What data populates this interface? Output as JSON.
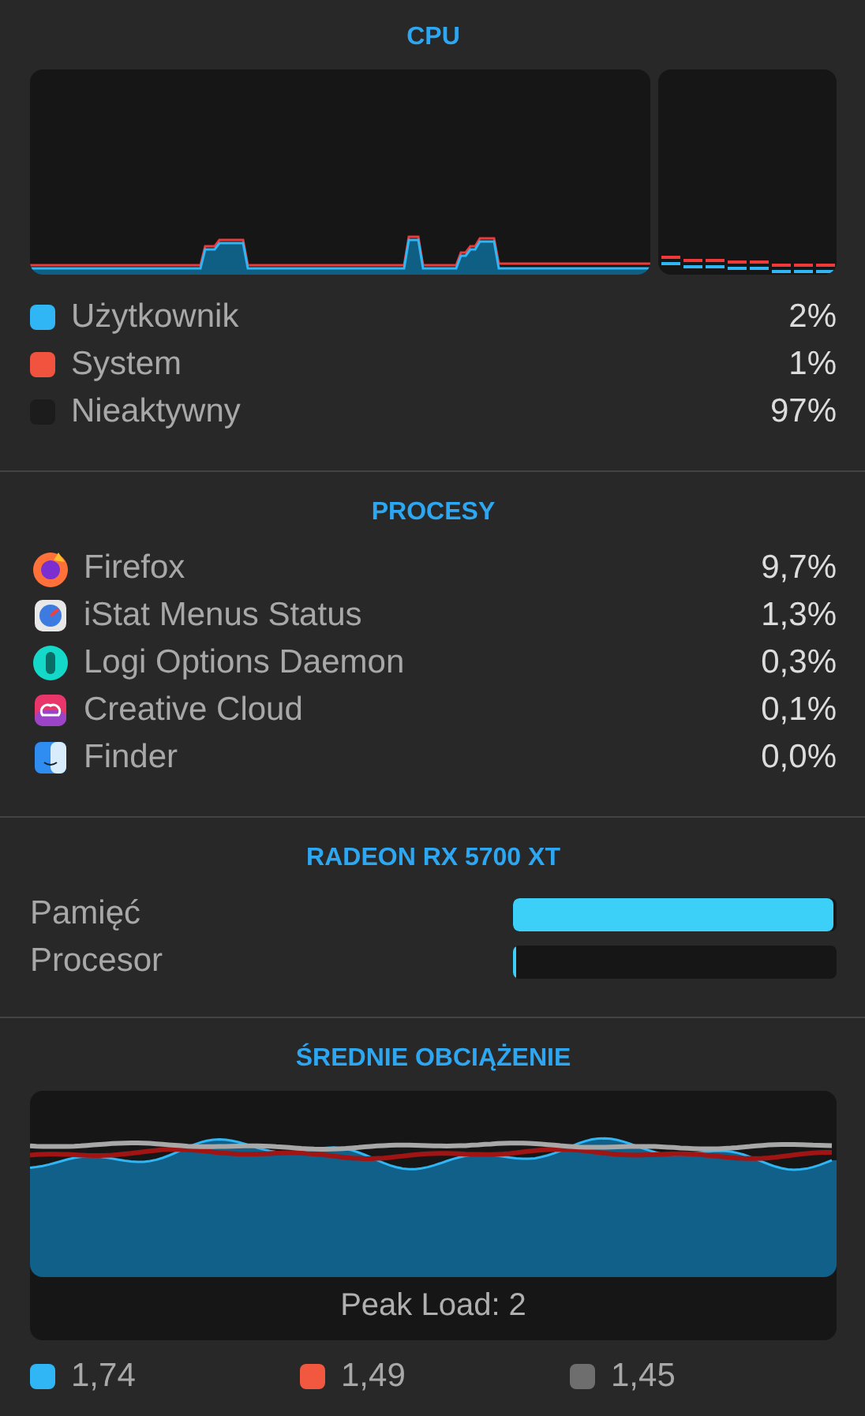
{
  "cpu": {
    "title": "CPU",
    "legend": [
      {
        "label": "Użytkownik",
        "value": "2%",
        "color": "#30b6f4"
      },
      {
        "label": "System",
        "value": "1%",
        "color": "#f2533e"
      },
      {
        "label": "Nieaktywny",
        "value": "97%",
        "color": "#1c1c1c"
      }
    ]
  },
  "processes": {
    "title": "PROCESY",
    "rows": [
      {
        "name": "Firefox",
        "value": "9,7%"
      },
      {
        "name": "iStat Menus Status",
        "value": "1,3%"
      },
      {
        "name": "Logi Options Daemon",
        "value": "0,3%"
      },
      {
        "name": "Creative Cloud",
        "value": "0,1%"
      },
      {
        "name": "Finder",
        "value": "0,0%"
      }
    ]
  },
  "gpu": {
    "title": "RADEON RX 5700 XT",
    "rows": [
      {
        "label": "Pamięć",
        "level": 0.99
      },
      {
        "label": "Procesor",
        "level": 0.01
      }
    ]
  },
  "load": {
    "title": "ŚREDNIE OBCIĄŻENIE",
    "peak": "Peak Load: 2",
    "legend": [
      {
        "value": "1,74",
        "color": "#30b6f4"
      },
      {
        "value": "1,49",
        "color": "#f2583f"
      },
      {
        "value": "1,45",
        "color": "#6e6e6e"
      }
    ]
  }
}
